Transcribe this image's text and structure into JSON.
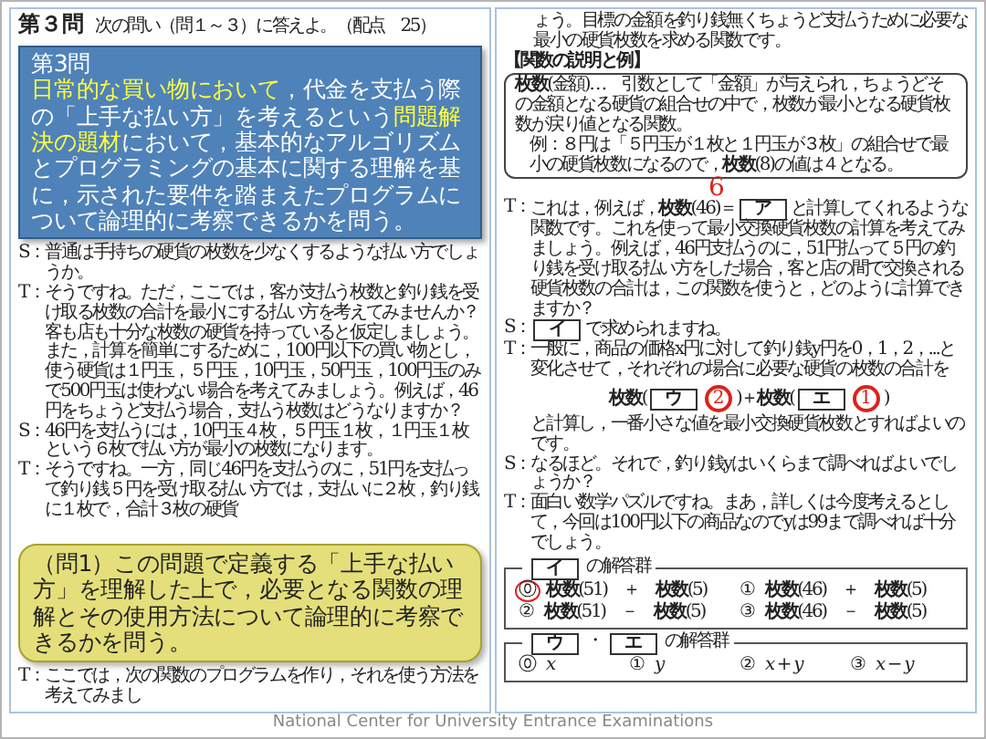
{
  "left_page": {
    "heading": {
      "number": "第３問",
      "instruction": "次の問い（問１～３）に答えよ。（配点　25）"
    },
    "dialogue": [
      {
        "speaker": "S：",
        "segments": [
          {
            "kind": "text",
            "text": "普通は手持ちの硬貨の枚数を少なくするような払い方でしょうか。"
          }
        ]
      },
      {
        "speaker": "T：",
        "segments": [
          {
            "kind": "text",
            "text": "そうですね。ただ，ここでは，客が支払う枚数と釣り銭を受け取る枚数の合計を最小にする払い方を考えてみませんか？客も店も十分な枚数の硬貨を持っていると仮定しましょう。また，計算を簡単にするために，100円以下の買い物とし，使う硬貨は１円玉，５円玉，10円玉，50円玉，100円玉のみで500円玉は使わない場合を考えてみましょう。例えば，46円をちょうど支払う場合，支払う枚数はどうなりますか？"
          }
        ]
      },
      {
        "speaker": "S：",
        "segments": [
          {
            "kind": "text",
            "text": "46円を支払うには，10円玉４枚，５円玉１枚，１円玉１枚という６枚で払い方が最小の枚数になります。"
          }
        ]
      },
      {
        "speaker": "T：",
        "segments": [
          {
            "kind": "text",
            "text": "そうですね。一方，同じ46円を支払うのに，51円を支払って釣り銭５円を受け取る払い方では，支払いに２枚，釣り銭に１枚で，合計３枚の硬貨"
          }
        ]
      }
    ],
    "last_line": {
      "speaker": "T：",
      "segments": [
        {
          "kind": "text",
          "text": "ここでは，次の関数のプログラムを作り，それを使う方法を考えてみまし"
        }
      ]
    }
  },
  "summary_callout": {
    "title": "第3問",
    "segments": [
      {
        "text": "日常的な買い物において",
        "highlighted": true
      },
      {
        "text": "，代金を支払う際の「上手な払い方」を考えるという",
        "highlighted": false
      },
      {
        "text": "問題解決の題材",
        "highlighted": true
      },
      {
        "text": "において，基本的なアルゴリズムとプログラミングの基本に関する理解を基に，示された要件を踏まえたプログラムについて論理的に考察できるかを問う。",
        "highlighted": false
      }
    ]
  },
  "question_callout": {
    "text": "（問1）この問題で定義する「上手な払い方」を理解した上で，必要となる関数の理解とその使用方法について論理的に考察できるかを問う。"
  },
  "right_page": {
    "intro": "ょう。目標の金額を釣り銭無くちょうど支払うために必要な最小の硬貨枚数を求める関数です。",
    "section_heading": "【関数の説明と例】",
    "definition": [
      "**枚数**(金額)…　引数として「金額」が与えられ，ちょうどその金額となる硬貨の組合せの中で，枚数が最小となる硬貨枚数が戻り値となる関数。",
      "例：８円は「５円玉が１枚と１円玉が３枚」の組合せで最小の硬貨枚数になるので，**枚数**(8)の値は４となる。"
    ],
    "dialogue": [
      {
        "speaker": "T：",
        "segments": [
          {
            "kind": "text",
            "text": "これは，例えば，**枚数**(46)＝"
          },
          {
            "kind": "blank",
            "text": "ア",
            "note": {
              "kind": "plain",
              "text": "6"
            }
          },
          {
            "kind": "text",
            "text": "と計算してくれるような関数です。これを使って最小交換硬貨枚数の計算を考えてみましょう。例えば，46円支払うのに，51円払って５円の釣り銭を受け取る払い方をした場合，客と店の間で交換される硬貨枚数の合計は，この関数を使うと，どのように計算できますか？"
          }
        ]
      },
      {
        "speaker": "S：",
        "segments": [
          {
            "kind": "blank",
            "text": "イ"
          },
          {
            "kind": "text",
            "text": "で求められますね。"
          }
        ]
      },
      {
        "speaker": "T：",
        "segments": [
          {
            "kind": "text",
            "text": "一般に，商品の価格x円に対して釣り銭y円を0，1，2，...と変化させて，それぞれの場合に必要な硬貨の枚数の合計を"
          },
          {
            "kind": "formula",
            "parts": [
              {
                "kind": "text",
                "text": "**枚数**("
              },
              {
                "kind": "blank",
                "text": "ウ",
                "note": {
                  "kind": "circled",
                  "text": "2"
                }
              },
              {
                "kind": "text",
                "text": ")＋**枚数**("
              },
              {
                "kind": "blank",
                "text": "エ",
                "note": {
                  "kind": "circled",
                  "text": "1"
                }
              },
              {
                "kind": "text",
                "text": ")"
              }
            ]
          },
          {
            "kind": "text",
            "text": "と計算し，一番小さな値を最小交換硬貨枚数とすればよいのです。"
          }
        ]
      },
      {
        "speaker": "S：",
        "segments": [
          {
            "kind": "text",
            "text": "なるほど。それで，釣り銭yはいくらまで調べればよいでしょうか？"
          }
        ]
      },
      {
        "speaker": "T：",
        "segments": [
          {
            "kind": "text",
            "text": "面白い数学パズルですね。まあ，詳しくは今度考えるとして，今回は100円以下の商品なのでyは99まで調べれば十分でしょう。"
          }
        ]
      }
    ],
    "answer_groups": [
      {
        "blanks": [
          "イ"
        ],
        "label": "の解答群",
        "options": [
          {
            "mark": "⓪",
            "text": "**枚数**(51)　＋　**枚数**(5)",
            "circled": true
          },
          {
            "mark": "①",
            "text": "**枚数**(46)　＋　**枚数**(5)",
            "circled": false
          },
          {
            "mark": "②",
            "text": "**枚数**(51)　－　**枚数**(5)",
            "circled": false
          },
          {
            "mark": "③",
            "text": "**枚数**(46)　－　**枚数**(5)",
            "circled": false
          }
        ]
      },
      {
        "blanks": [
          "ウ",
          "エ"
        ],
        "separator": "・",
        "label": "の解答群",
        "options": [
          {
            "mark": "⓪",
            "text": "*x*",
            "circled": false
          },
          {
            "mark": "①",
            "text": "*y*",
            "circled": false
          },
          {
            "mark": "②",
            "text": "*x* + *y*",
            "circled": false
          },
          {
            "mark": "③",
            "text": "*x* − *y*",
            "circled": false
          }
        ]
      }
    ]
  },
  "footer": "National Center for University Entrance Examinations"
}
